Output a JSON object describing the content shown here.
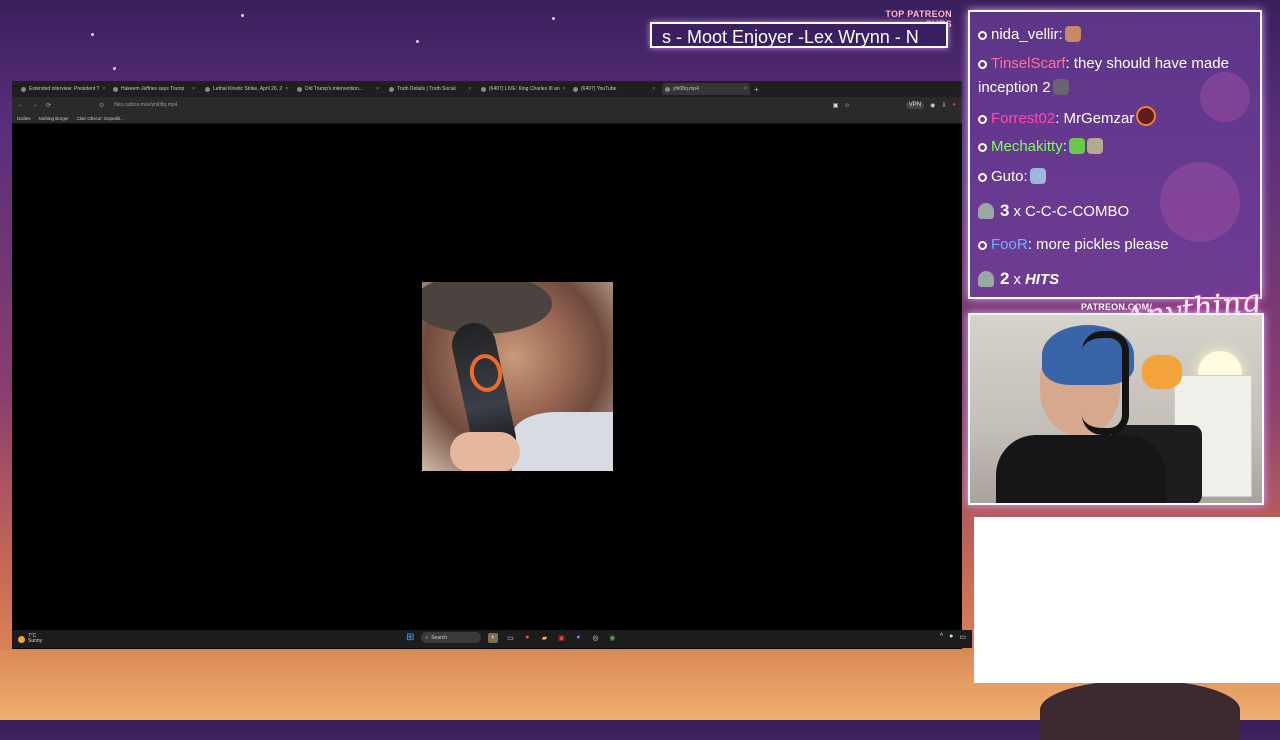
{
  "overlay": {
    "patreon_label": "TOP PATREON SUBS",
    "ticker_text": "s - Moot Enjoyer -Lex Wrynn -  N",
    "patreon_url": "PATREON.COM/",
    "logo_text": "Anything else?"
  },
  "browser": {
    "tabs": [
      {
        "title": "Extended interview: President T"
      },
      {
        "title": "Hakeem Jeffries says Trump"
      },
      {
        "title": "Lethal Kinetic Strike, April 26, 2"
      },
      {
        "title": "Did Trump's intervention..."
      },
      {
        "title": "Truth Details | Truth Social"
      },
      {
        "title": "(6407) LIVE: King Charles III an"
      },
      {
        "title": "(6407) YouTube"
      },
      {
        "title": "yhi08q.mp4",
        "active": true
      }
    ],
    "new_tab": "+",
    "url": "files.catbox.moe/yhi08q.mp4",
    "vpn_label": "VPN",
    "bookmarks": [
      {
        "label": "Dailies"
      },
      {
        "label": "Nothing Burger"
      },
      {
        "label": "Clair Obscur: Expediti..."
      }
    ]
  },
  "taskbar": {
    "weather_temp": "7°C",
    "weather_desc": "Sunny",
    "search_label": "Search"
  },
  "chat": {
    "messages": [
      {
        "user": "nida_vellir",
        "color": "#ffffff",
        "text": ""
      },
      {
        "user": "TinselScarf",
        "color": "#ff6fa0",
        "text": " they should have made inception 2"
      },
      {
        "user": "Forrest02",
        "color": "#ff4aa8",
        "text": " MrGemzar"
      },
      {
        "user": "Mechakitty",
        "color": "#7cff5a",
        "text": ""
      },
      {
        "user": "Guto",
        "color": "#ffffff",
        "text": ""
      },
      {
        "user": "FooR",
        "color": "#6fb0ff",
        "text": " more pickles please"
      }
    ],
    "combo1": {
      "count": "3",
      "x": "x",
      "label": "C-C-C-COMBO"
    },
    "combo2": {
      "count": "2",
      "x": "x",
      "label": "HITS"
    }
  },
  "colors": {
    "accent": "#b48aff",
    "ticker_bg": "#3a2063"
  }
}
